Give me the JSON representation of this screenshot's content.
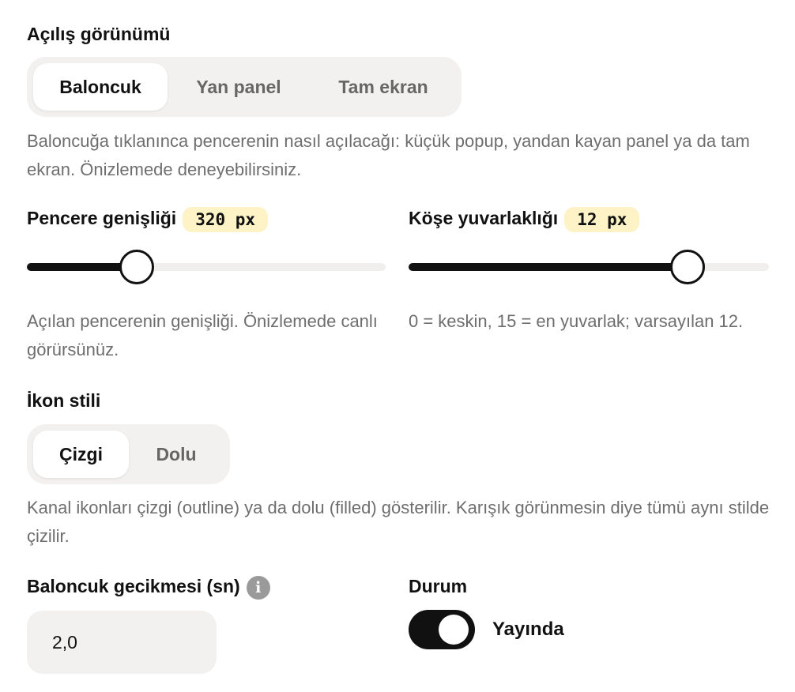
{
  "opening_view": {
    "title": "Açılış görünümü",
    "options": [
      "Baloncuk",
      "Yan panel",
      "Tam ekran"
    ],
    "selected": "Baloncuk",
    "description": "Baloncuğa tıklanınca pencerenin nasıl açılacağı: küçük popup, yandan kayan panel ya da tam ekran. Önizlemede deneyebilirsiniz."
  },
  "window_width": {
    "title": "Pencere genişliği",
    "value_label": "320 px",
    "value": 320,
    "fill_fraction": 0.33,
    "description": "Açılan pencerenin genişliği. Önizlemede canlı görürsünüz."
  },
  "corner_radius": {
    "title": "Köşe yuvarlaklığı",
    "value_label": "12 px",
    "value": 12,
    "min": 0,
    "max": 15,
    "fill_fraction": 0.8,
    "description": "0 = keskin, 15 = en yuvarlak; varsayılan 12."
  },
  "icon_style": {
    "title": "İkon stili",
    "options": [
      "Çizgi",
      "Dolu"
    ],
    "selected": "Çizgi",
    "description": "Kanal ikonları çizgi (outline) ya da dolu (filled) gösterilir. Karışık görünmesin diye tümü aynı stilde çizilir."
  },
  "bubble_delay": {
    "title": "Baloncuk gecikmesi (sn)",
    "info_glyph": "i",
    "value": "2,0"
  },
  "status": {
    "title": "Durum",
    "toggle_on": true,
    "label": "Yayında"
  },
  "colors": {
    "accent": "#111111",
    "badge_bg": "#fdf3c7",
    "segment_bg": "#f2f1ef",
    "muted_text": "#6e6e6e"
  }
}
